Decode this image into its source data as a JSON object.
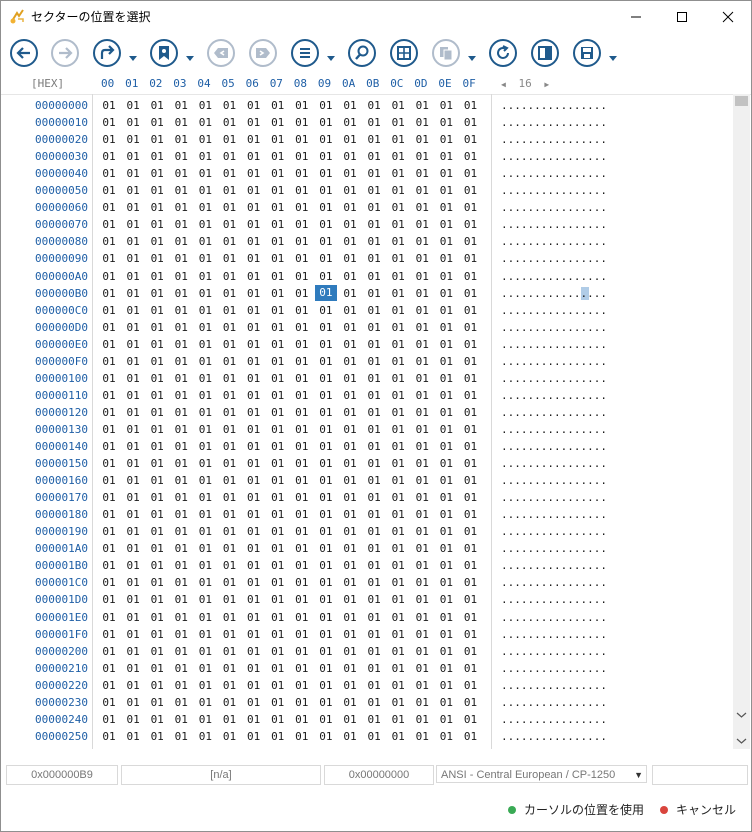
{
  "window": {
    "title": "セクターの位置を選択",
    "accent": "#2f7bbd"
  },
  "toolbar": {
    "buttons": [
      {
        "icon": "back-arrow-icon"
      },
      {
        "icon": "forward-arrow-icon"
      },
      {
        "icon": "redirect-arrow-icon"
      },
      {
        "icon": "bookmark-icon"
      },
      {
        "icon": "previous-bookmark-icon"
      },
      {
        "icon": "next-bookmark-icon"
      },
      {
        "icon": "list-icon"
      },
      {
        "icon": "search-icon"
      },
      {
        "icon": "grid-icon"
      },
      {
        "icon": "copy-icon"
      },
      {
        "icon": "refresh-icon"
      },
      {
        "icon": "panel-icon"
      },
      {
        "icon": "save-icon"
      }
    ]
  },
  "hex_header": {
    "label": "[HEX]",
    "columns": [
      "00",
      "01",
      "02",
      "03",
      "04",
      "05",
      "06",
      "07",
      "08",
      "09",
      "0A",
      "0B",
      "0C",
      "0D",
      "0E",
      "0F"
    ],
    "width_left": "◀",
    "width_value": "16",
    "width_right": "▶"
  },
  "hex_view": {
    "rows": [
      {
        "offset": "00000000",
        "bytes": [
          "01",
          "01",
          "01",
          "01",
          "01",
          "01",
          "01",
          "01",
          "01",
          "01",
          "01",
          "01",
          "01",
          "01",
          "01",
          "01"
        ],
        "ascii": "................"
      },
      {
        "offset": "00000010",
        "bytes": [
          "01",
          "01",
          "01",
          "01",
          "01",
          "01",
          "01",
          "01",
          "01",
          "01",
          "01",
          "01",
          "01",
          "01",
          "01",
          "01"
        ],
        "ascii": "................"
      },
      {
        "offset": "00000020",
        "bytes": [
          "01",
          "01",
          "01",
          "01",
          "01",
          "01",
          "01",
          "01",
          "01",
          "01",
          "01",
          "01",
          "01",
          "01",
          "01",
          "01"
        ],
        "ascii": "................"
      },
      {
        "offset": "00000030",
        "bytes": [
          "01",
          "01",
          "01",
          "01",
          "01",
          "01",
          "01",
          "01",
          "01",
          "01",
          "01",
          "01",
          "01",
          "01",
          "01",
          "01"
        ],
        "ascii": "................"
      },
      {
        "offset": "00000040",
        "bytes": [
          "01",
          "01",
          "01",
          "01",
          "01",
          "01",
          "01",
          "01",
          "01",
          "01",
          "01",
          "01",
          "01",
          "01",
          "01",
          "01"
        ],
        "ascii": "................"
      },
      {
        "offset": "00000050",
        "bytes": [
          "01",
          "01",
          "01",
          "01",
          "01",
          "01",
          "01",
          "01",
          "01",
          "01",
          "01",
          "01",
          "01",
          "01",
          "01",
          "01"
        ],
        "ascii": "................"
      },
      {
        "offset": "00000060",
        "bytes": [
          "01",
          "01",
          "01",
          "01",
          "01",
          "01",
          "01",
          "01",
          "01",
          "01",
          "01",
          "01",
          "01",
          "01",
          "01",
          "01"
        ],
        "ascii": "................"
      },
      {
        "offset": "00000070",
        "bytes": [
          "01",
          "01",
          "01",
          "01",
          "01",
          "01",
          "01",
          "01",
          "01",
          "01",
          "01",
          "01",
          "01",
          "01",
          "01",
          "01"
        ],
        "ascii": "................"
      },
      {
        "offset": "00000080",
        "bytes": [
          "01",
          "01",
          "01",
          "01",
          "01",
          "01",
          "01",
          "01",
          "01",
          "01",
          "01",
          "01",
          "01",
          "01",
          "01",
          "01"
        ],
        "ascii": "................"
      },
      {
        "offset": "00000090",
        "bytes": [
          "01",
          "01",
          "01",
          "01",
          "01",
          "01",
          "01",
          "01",
          "01",
          "01",
          "01",
          "01",
          "01",
          "01",
          "01",
          "01"
        ],
        "ascii": "................"
      },
      {
        "offset": "000000A0",
        "bytes": [
          "01",
          "01",
          "01",
          "01",
          "01",
          "01",
          "01",
          "01",
          "01",
          "01",
          "01",
          "01",
          "01",
          "01",
          "01",
          "01"
        ],
        "ascii": "................"
      },
      {
        "offset": "000000B0",
        "bytes": [
          "01",
          "01",
          "01",
          "01",
          "01",
          "01",
          "01",
          "01",
          "01",
          "01",
          "01",
          "01",
          "01",
          "01",
          "01",
          "01"
        ],
        "ascii": "................"
      },
      {
        "offset": "000000C0",
        "bytes": [
          "01",
          "01",
          "01",
          "01",
          "01",
          "01",
          "01",
          "01",
          "01",
          "01",
          "01",
          "01",
          "01",
          "01",
          "01",
          "01"
        ],
        "ascii": "................"
      },
      {
        "offset": "000000D0",
        "bytes": [
          "01",
          "01",
          "01",
          "01",
          "01",
          "01",
          "01",
          "01",
          "01",
          "01",
          "01",
          "01",
          "01",
          "01",
          "01",
          "01"
        ],
        "ascii": "................"
      },
      {
        "offset": "000000E0",
        "bytes": [
          "01",
          "01",
          "01",
          "01",
          "01",
          "01",
          "01",
          "01",
          "01",
          "01",
          "01",
          "01",
          "01",
          "01",
          "01",
          "01"
        ],
        "ascii": "................"
      },
      {
        "offset": "000000F0",
        "bytes": [
          "01",
          "01",
          "01",
          "01",
          "01",
          "01",
          "01",
          "01",
          "01",
          "01",
          "01",
          "01",
          "01",
          "01",
          "01",
          "01"
        ],
        "ascii": "................"
      },
      {
        "offset": "00000100",
        "bytes": [
          "01",
          "01",
          "01",
          "01",
          "01",
          "01",
          "01",
          "01",
          "01",
          "01",
          "01",
          "01",
          "01",
          "01",
          "01",
          "01"
        ],
        "ascii": "................"
      },
      {
        "offset": "00000110",
        "bytes": [
          "01",
          "01",
          "01",
          "01",
          "01",
          "01",
          "01",
          "01",
          "01",
          "01",
          "01",
          "01",
          "01",
          "01",
          "01",
          "01"
        ],
        "ascii": "................"
      },
      {
        "offset": "00000120",
        "bytes": [
          "01",
          "01",
          "01",
          "01",
          "01",
          "01",
          "01",
          "01",
          "01",
          "01",
          "01",
          "01",
          "01",
          "01",
          "01",
          "01"
        ],
        "ascii": "................"
      },
      {
        "offset": "00000130",
        "bytes": [
          "01",
          "01",
          "01",
          "01",
          "01",
          "01",
          "01",
          "01",
          "01",
          "01",
          "01",
          "01",
          "01",
          "01",
          "01",
          "01"
        ],
        "ascii": "................"
      },
      {
        "offset": "00000140",
        "bytes": [
          "01",
          "01",
          "01",
          "01",
          "01",
          "01",
          "01",
          "01",
          "01",
          "01",
          "01",
          "01",
          "01",
          "01",
          "01",
          "01"
        ],
        "ascii": "................"
      },
      {
        "offset": "00000150",
        "bytes": [
          "01",
          "01",
          "01",
          "01",
          "01",
          "01",
          "01",
          "01",
          "01",
          "01",
          "01",
          "01",
          "01",
          "01",
          "01",
          "01"
        ],
        "ascii": "................"
      },
      {
        "offset": "00000160",
        "bytes": [
          "01",
          "01",
          "01",
          "01",
          "01",
          "01",
          "01",
          "01",
          "01",
          "01",
          "01",
          "01",
          "01",
          "01",
          "01",
          "01"
        ],
        "ascii": "................"
      },
      {
        "offset": "00000170",
        "bytes": [
          "01",
          "01",
          "01",
          "01",
          "01",
          "01",
          "01",
          "01",
          "01",
          "01",
          "01",
          "01",
          "01",
          "01",
          "01",
          "01"
        ],
        "ascii": "................"
      },
      {
        "offset": "00000180",
        "bytes": [
          "01",
          "01",
          "01",
          "01",
          "01",
          "01",
          "01",
          "01",
          "01",
          "01",
          "01",
          "01",
          "01",
          "01",
          "01",
          "01"
        ],
        "ascii": "................"
      },
      {
        "offset": "00000190",
        "bytes": [
          "01",
          "01",
          "01",
          "01",
          "01",
          "01",
          "01",
          "01",
          "01",
          "01",
          "01",
          "01",
          "01",
          "01",
          "01",
          "01"
        ],
        "ascii": "................"
      },
      {
        "offset": "000001A0",
        "bytes": [
          "01",
          "01",
          "01",
          "01",
          "01",
          "01",
          "01",
          "01",
          "01",
          "01",
          "01",
          "01",
          "01",
          "01",
          "01",
          "01"
        ],
        "ascii": "................"
      },
      {
        "offset": "000001B0",
        "bytes": [
          "01",
          "01",
          "01",
          "01",
          "01",
          "01",
          "01",
          "01",
          "01",
          "01",
          "01",
          "01",
          "01",
          "01",
          "01",
          "01"
        ],
        "ascii": "................"
      },
      {
        "offset": "000001C0",
        "bytes": [
          "01",
          "01",
          "01",
          "01",
          "01",
          "01",
          "01",
          "01",
          "01",
          "01",
          "01",
          "01",
          "01",
          "01",
          "01",
          "01"
        ],
        "ascii": "................"
      },
      {
        "offset": "000001D0",
        "bytes": [
          "01",
          "01",
          "01",
          "01",
          "01",
          "01",
          "01",
          "01",
          "01",
          "01",
          "01",
          "01",
          "01",
          "01",
          "01",
          "01"
        ],
        "ascii": "................"
      },
      {
        "offset": "000001E0",
        "bytes": [
          "01",
          "01",
          "01",
          "01",
          "01",
          "01",
          "01",
          "01",
          "01",
          "01",
          "01",
          "01",
          "01",
          "01",
          "01",
          "01"
        ],
        "ascii": "................"
      },
      {
        "offset": "000001F0",
        "bytes": [
          "01",
          "01",
          "01",
          "01",
          "01",
          "01",
          "01",
          "01",
          "01",
          "01",
          "01",
          "01",
          "01",
          "01",
          "01",
          "01"
        ],
        "ascii": "................"
      },
      {
        "offset": "00000200",
        "bytes": [
          "01",
          "01",
          "01",
          "01",
          "01",
          "01",
          "01",
          "01",
          "01",
          "01",
          "01",
          "01",
          "01",
          "01",
          "01",
          "01"
        ],
        "ascii": "................"
      },
      {
        "offset": "00000210",
        "bytes": [
          "01",
          "01",
          "01",
          "01",
          "01",
          "01",
          "01",
          "01",
          "01",
          "01",
          "01",
          "01",
          "01",
          "01",
          "01",
          "01"
        ],
        "ascii": "................"
      },
      {
        "offset": "00000220",
        "bytes": [
          "01",
          "01",
          "01",
          "01",
          "01",
          "01",
          "01",
          "01",
          "01",
          "01",
          "01",
          "01",
          "01",
          "01",
          "01",
          "01"
        ],
        "ascii": "................"
      },
      {
        "offset": "00000230",
        "bytes": [
          "01",
          "01",
          "01",
          "01",
          "01",
          "01",
          "01",
          "01",
          "01",
          "01",
          "01",
          "01",
          "01",
          "01",
          "01",
          "01"
        ],
        "ascii": "................"
      },
      {
        "offset": "00000240",
        "bytes": [
          "01",
          "01",
          "01",
          "01",
          "01",
          "01",
          "01",
          "01",
          "01",
          "01",
          "01",
          "01",
          "01",
          "01",
          "01",
          "01"
        ],
        "ascii": "................"
      },
      {
        "offset": "00000250",
        "bytes": [
          "01",
          "01",
          "01",
          "01",
          "01",
          "01",
          "01",
          "01",
          "01",
          "01",
          "01",
          "01",
          "01",
          "01",
          "01",
          "01"
        ],
        "ascii": "................"
      }
    ],
    "selected_row": 11,
    "selected_col": 9
  },
  "status": {
    "cursor_offset": "0x000000B9",
    "value": "[n/a]",
    "sector_offset": "0x00000000",
    "encoding": "ANSI - Central European / CP-1250",
    "extra": ""
  },
  "actions": {
    "use_cursor": "カーソルの位置を使用",
    "use_cursor_color": "#3aaa55",
    "cancel": "キャンセル",
    "cancel_color": "#d9453d"
  }
}
